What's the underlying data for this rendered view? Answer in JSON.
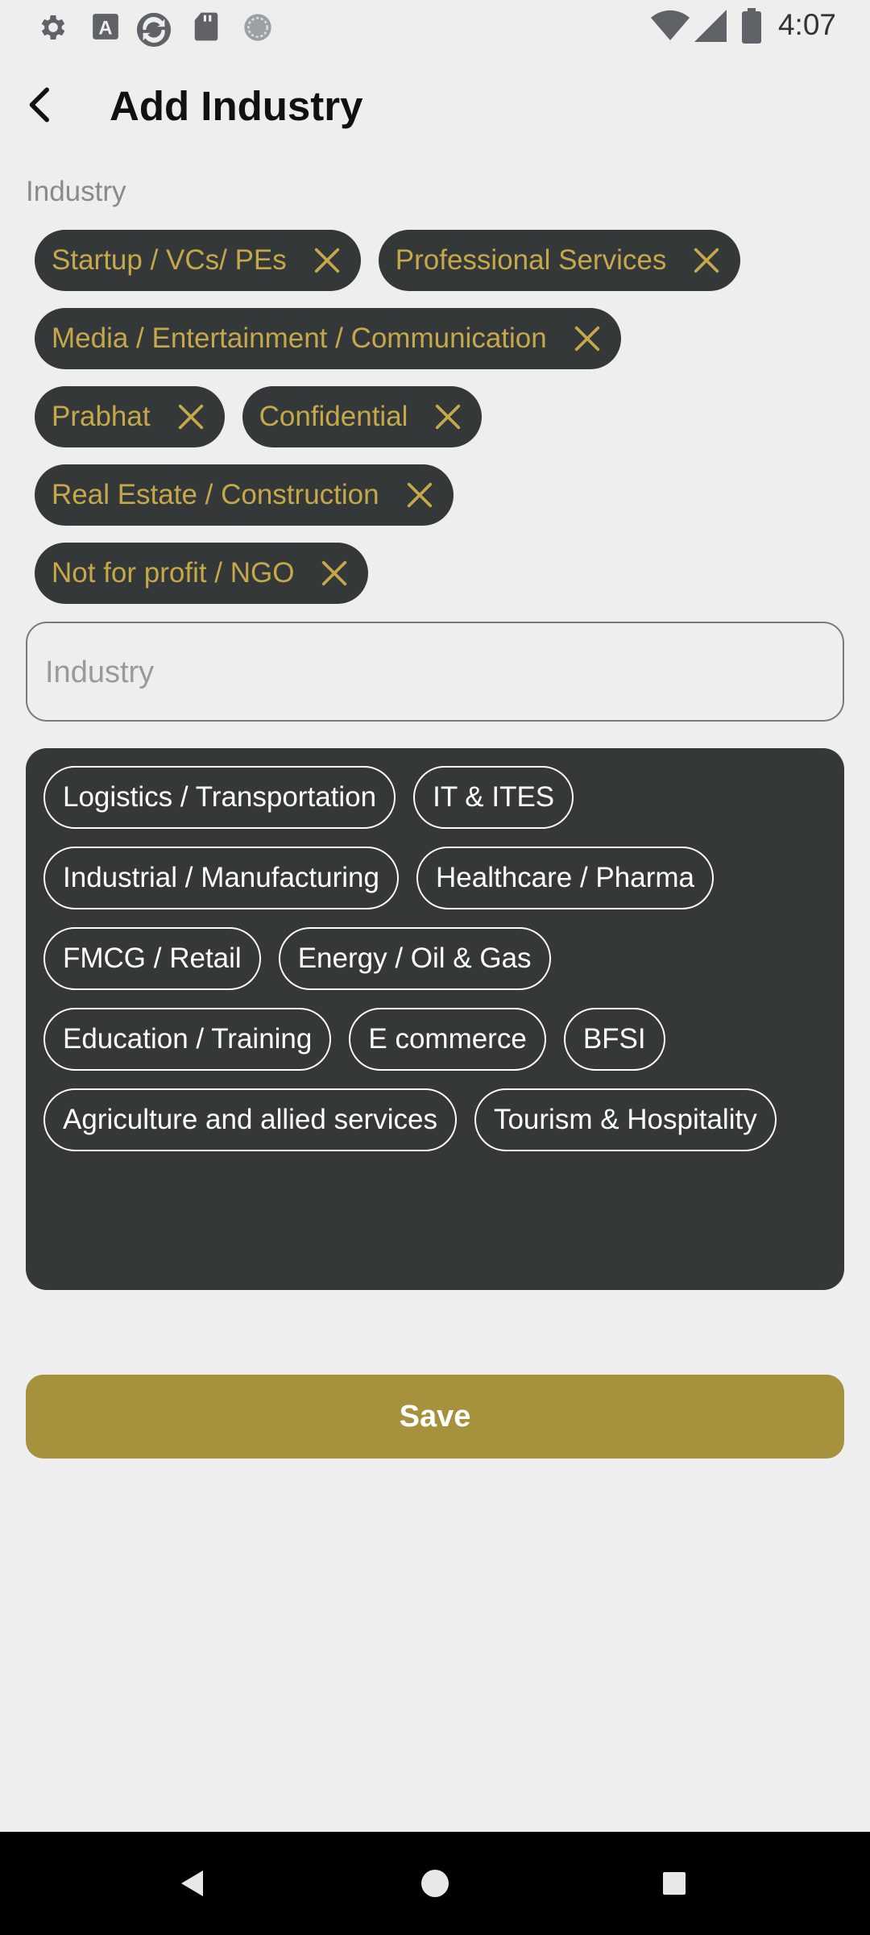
{
  "status_bar": {
    "time": "4:07",
    "left_icons": [
      "gear-icon",
      "font-a-icon",
      "sync-icon",
      "sd-card-icon",
      "circle-dots-icon"
    ],
    "right_icons": [
      "wifi-icon",
      "signal-icon",
      "battery-icon"
    ]
  },
  "header": {
    "title": "Add Industry",
    "back_icon": "arrow-left-icon"
  },
  "form": {
    "label": "Industry",
    "selected": [
      [
        "Startup / VCs/ PEs",
        "Professional Services"
      ],
      [
        "Media / Entertainment / Communication"
      ],
      [
        "Prabhat",
        "Confidential"
      ],
      [
        "Real Estate / Construction"
      ],
      [
        "Not for profit / NGO"
      ]
    ],
    "input": {
      "placeholder": "Industry",
      "value": ""
    },
    "suggestions": [
      [
        "Logistics / Transportation",
        "IT & ITES"
      ],
      [
        "Industrial / Manufacturing",
        "Healthcare / Pharma"
      ],
      [
        "FMCG / Retail",
        "Energy / Oil & Gas"
      ],
      [
        "Education / Training",
        "E commerce",
        "BFSI"
      ],
      [
        "Agriculture and allied services",
        "Tourism & Hospitality"
      ]
    ],
    "save_label": "Save"
  },
  "colors": {
    "background": "#eeeeee",
    "chip_bg": "#353839",
    "chip_text": "#c4a84a",
    "save_button": "#a6913d"
  },
  "nav_bar": {
    "icons": [
      "nav-back-icon",
      "nav-home-icon",
      "nav-recents-icon"
    ]
  }
}
